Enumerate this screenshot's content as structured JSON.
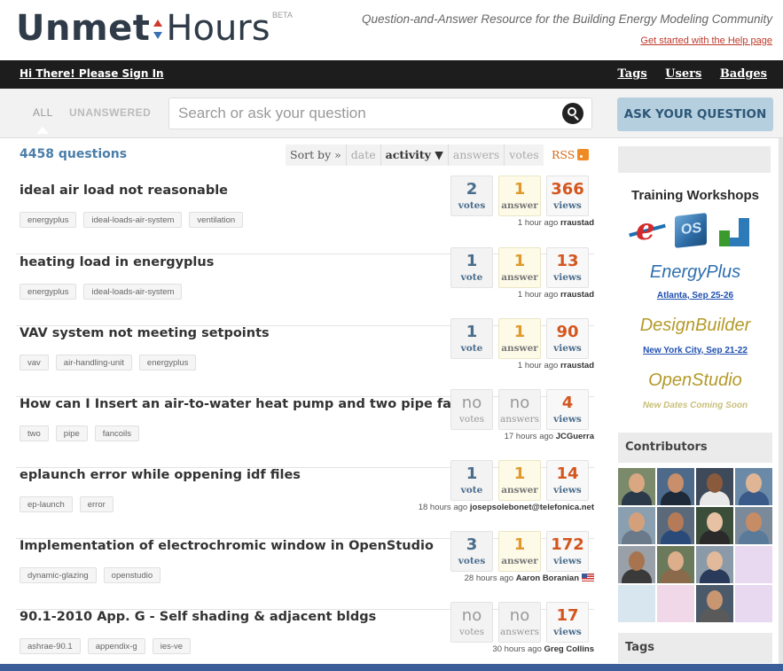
{
  "brand": {
    "logo_left": "Unmet",
    "logo_right": "Hours",
    "beta": "BETA",
    "tagline": "Question-and-Answer Resource for the Building Energy Modeling Community",
    "help_link": "Get started with the Help page"
  },
  "topbar": {
    "signin": "Hi There! Please Sign In",
    "nav": [
      "Tags",
      "Users",
      "Badges"
    ]
  },
  "search": {
    "tab_all": "ALL",
    "tab_unanswered": "UNANSWERED",
    "placeholder": "Search or ask your question",
    "ask_button": "ASK YOUR QUESTION"
  },
  "list": {
    "count": "4458 questions",
    "sort_label": "Sort by »",
    "sort_options": [
      "date",
      "activity ▼",
      "answers",
      "votes"
    ],
    "rss": "RSS"
  },
  "questions": [
    {
      "title": "ideal air load not reasonable",
      "tags": [
        "energyplus",
        "ideal-loads-air-system",
        "ventilation"
      ],
      "votes": "2",
      "votes_label": "votes",
      "answers": "1",
      "answers_label": "answer",
      "views": "366",
      "views_label": "views",
      "time": "1 hour ago",
      "user": "rraustad",
      "votes_zero": false,
      "answers_zero": false
    },
    {
      "title": "heating load in energyplus",
      "tags": [
        "energyplus",
        "ideal-loads-air-system"
      ],
      "votes": "1",
      "votes_label": "vote",
      "answers": "1",
      "answers_label": "answer",
      "views": "13",
      "views_label": "views",
      "time": "1 hour ago",
      "user": "rraustad",
      "votes_zero": false,
      "answers_zero": false
    },
    {
      "title": "VAV system not meeting setpoints",
      "tags": [
        "vav",
        "air-handling-unit",
        "energyplus"
      ],
      "votes": "1",
      "votes_label": "vote",
      "answers": "1",
      "answers_label": "answer",
      "views": "90",
      "views_label": "views",
      "time": "1 hour ago",
      "user": "rraustad",
      "votes_zero": false,
      "answers_zero": false
    },
    {
      "title": "How can I Insert an air-to-water heat pump and two pipe fancoils",
      "tags": [
        "two",
        "pipe",
        "fancoils"
      ],
      "votes": "no",
      "votes_label": "votes",
      "answers": "no",
      "answers_label": "answers",
      "views": "4",
      "views_label": "views",
      "time": "17 hours ago",
      "user": "JCGuerra",
      "votes_zero": true,
      "answers_zero": true
    },
    {
      "title": "eplaunch error while oppening idf files",
      "tags": [
        "ep-launch",
        "error"
      ],
      "votes": "1",
      "votes_label": "vote",
      "answers": "1",
      "answers_label": "answer",
      "views": "14",
      "views_label": "views",
      "time": "18 hours ago",
      "user": "josepsolebonet@telefonica.net",
      "votes_zero": false,
      "answers_zero": false
    },
    {
      "title": "Implementation of electrochromic window in OpenStudio",
      "tags": [
        "dynamic-glazing",
        "openstudio"
      ],
      "votes": "3",
      "votes_label": "votes",
      "answers": "1",
      "answers_label": "answer",
      "views": "172",
      "views_label": "views",
      "time": "28 hours ago",
      "user": "Aaron Boranian",
      "votes_zero": false,
      "answers_zero": false
    },
    {
      "title": "90.1-2010 App. G - Self shading & adjacent bldgs",
      "tags": [
        "ashrae-90.1",
        "appendix-g",
        "ies-ve"
      ],
      "votes": "no",
      "votes_label": "votes",
      "answers": "no",
      "answers_label": "answers",
      "views": "17",
      "views_label": "views",
      "time": "30 hours ago",
      "user": "Greg Collins",
      "votes_zero": true,
      "answers_zero": true
    }
  ],
  "sidebar": {
    "training_title": "Training Workshops",
    "programs": [
      {
        "name": "EnergyPlus",
        "detail": "Atlanta, Sep 25-26",
        "color": "#2e6fb0"
      },
      {
        "name": "DesignBuilder",
        "detail": "New York City, Sep 21-22",
        "color": "#b49a2a"
      },
      {
        "name": "OpenStudio",
        "detail": "New Dates Coming Soon",
        "color": "#b49a2a"
      }
    ],
    "logos": [
      "energyplus-logo",
      "openstudio-logo",
      "designbuilder-logo"
    ],
    "os_logo_text": "OS",
    "contributors_title": "Contributors",
    "tags_title": "Tags"
  },
  "colors": {
    "accent_blue": "#4a7da8",
    "answers_orange": "#e09a2b",
    "views_red": "#d4561f",
    "topbar": "#1d1d1d"
  }
}
